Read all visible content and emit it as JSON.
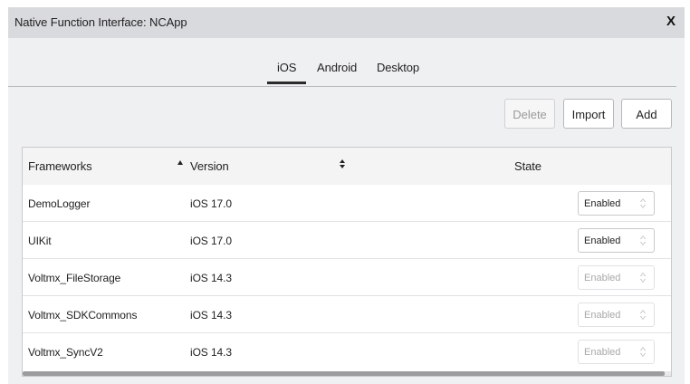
{
  "window": {
    "title": "Native Function Interface: NCApp",
    "close_glyph": "X"
  },
  "tabs": [
    {
      "label": "iOS",
      "active": true
    },
    {
      "label": "Android",
      "active": false
    },
    {
      "label": "Desktop",
      "active": false
    }
  ],
  "toolbar": {
    "delete_label": "Delete",
    "import_label": "Import",
    "add_label": "Add"
  },
  "table": {
    "headers": {
      "framework": "Frameworks",
      "version": "Version",
      "state": "State"
    },
    "rows": [
      {
        "name": "DemoLogger",
        "version": "iOS 17.0",
        "state": "Enabled",
        "state_enabled": true
      },
      {
        "name": "UIKit",
        "version": "iOS 17.0",
        "state": "Enabled",
        "state_enabled": true
      },
      {
        "name": "Voltmx_FileStorage",
        "version": "iOS 14.3",
        "state": "Enabled",
        "state_enabled": false
      },
      {
        "name": "Voltmx_SDKCommons",
        "version": "iOS 14.3",
        "state": "Enabled",
        "state_enabled": false
      },
      {
        "name": "Voltmx_SyncV2",
        "version": "iOS 14.3",
        "state": "Enabled",
        "state_enabled": false
      }
    ]
  },
  "icons": {
    "close": "close-icon",
    "sort_asc": "sort-ascending-icon",
    "sort_both": "sort-icon",
    "select_arrows": "chevron-up-down-icon"
  }
}
